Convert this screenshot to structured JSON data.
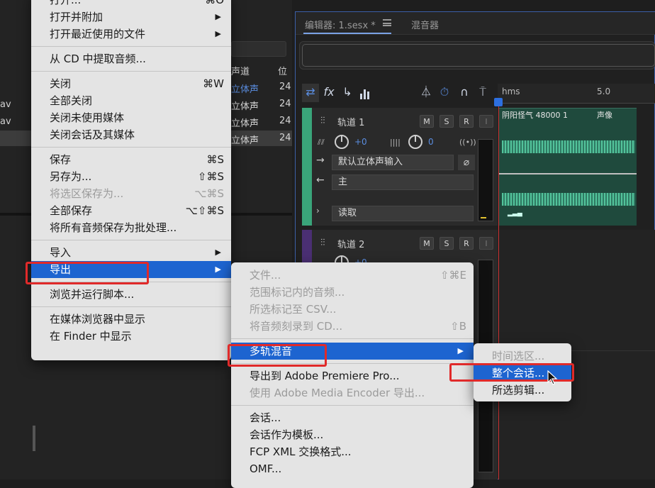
{
  "left_panel": {
    "files": [
      "av",
      "av"
    ],
    "channel_header": "声道",
    "position_header": "位",
    "channel_values": [
      "立体声",
      "立体声",
      "立体声",
      "立体声"
    ],
    "position_values": [
      "24",
      "24",
      "24",
      "24"
    ]
  },
  "editor": {
    "tab_editor": "编辑器: 1.sesx *",
    "tab_mixer": "混音器",
    "menu_icon": "hamburger-icon",
    "ruler": {
      "unit": "hms",
      "mark": "5.0"
    },
    "tracks": [
      {
        "name": "轨道 1",
        "volume": "+0",
        "pan": "0",
        "input": "默认立体声输入",
        "output": "主",
        "mode": "读取"
      },
      {
        "name": "轨道 2",
        "volume": "+0"
      }
    ],
    "clip": {
      "name": "阴阳怪气 48000 1",
      "label": "声像"
    },
    "msr": [
      "M",
      "S",
      "R",
      "I"
    ]
  },
  "file_menu": {
    "items": [
      {
        "label": "打开...",
        "shortcut": "⌘O"
      },
      {
        "label": "打开并附加",
        "submenu": true
      },
      {
        "label": "打开最近使用的文件",
        "submenu": true
      },
      {
        "sep": true
      },
      {
        "label": "从 CD 中提取音频..."
      },
      {
        "sep": true
      },
      {
        "label": "关闭",
        "shortcut": "⌘W"
      },
      {
        "label": "全部关闭"
      },
      {
        "label": "关闭未使用媒体"
      },
      {
        "label": "关闭会话及其媒体"
      },
      {
        "sep": true
      },
      {
        "label": "保存",
        "shortcut": "⌘S"
      },
      {
        "label": "另存为...",
        "shortcut": "⇧⌘S"
      },
      {
        "label": "将选区保存为...",
        "shortcut": "⌥⌘S",
        "disabled": true
      },
      {
        "label": "全部保存",
        "shortcut": "⌥⇧⌘S"
      },
      {
        "label": "将所有音频保存为批处理..."
      },
      {
        "sep": true
      },
      {
        "label": "导入",
        "submenu": true
      },
      {
        "label": "导出",
        "submenu": true,
        "highlighted": true
      },
      {
        "sep": true
      },
      {
        "label": "浏览并运行脚本..."
      },
      {
        "sep": true
      },
      {
        "label": "在媒体浏览器中显示"
      },
      {
        "label": "在 Finder 中显示"
      }
    ]
  },
  "export_menu": {
    "items": [
      {
        "label": "文件...",
        "shortcut": "⇧⌘E",
        "disabled": true
      },
      {
        "label": "范围标记内的音频...",
        "disabled": true
      },
      {
        "label": "所选标记至 CSV...",
        "disabled": true
      },
      {
        "label": "将音频刻录到 CD...",
        "shortcut": "⇧B",
        "disabled": true
      },
      {
        "sep": true
      },
      {
        "label": "多轨混音",
        "submenu": true,
        "highlighted": true
      },
      {
        "sep": true
      },
      {
        "label": "导出到 Adobe Premiere Pro..."
      },
      {
        "label": "使用 Adobe Media Encoder 导出...",
        "disabled": true
      },
      {
        "sep": true
      },
      {
        "label": "会话..."
      },
      {
        "label": "会话作为模板..."
      },
      {
        "label": "FCP XML 交换格式..."
      },
      {
        "label": "OMF..."
      }
    ]
  },
  "multitrack_menu": {
    "items": [
      {
        "label": "时间选区...",
        "disabled": true
      },
      {
        "label": "整个会话...",
        "highlighted": true
      },
      {
        "label": "所选剪辑..."
      }
    ]
  },
  "colors": {
    "highlight": "#1d64d0",
    "annotation": "#e02a2a",
    "track1": "#3aa57a",
    "track2": "#4a2f73"
  }
}
